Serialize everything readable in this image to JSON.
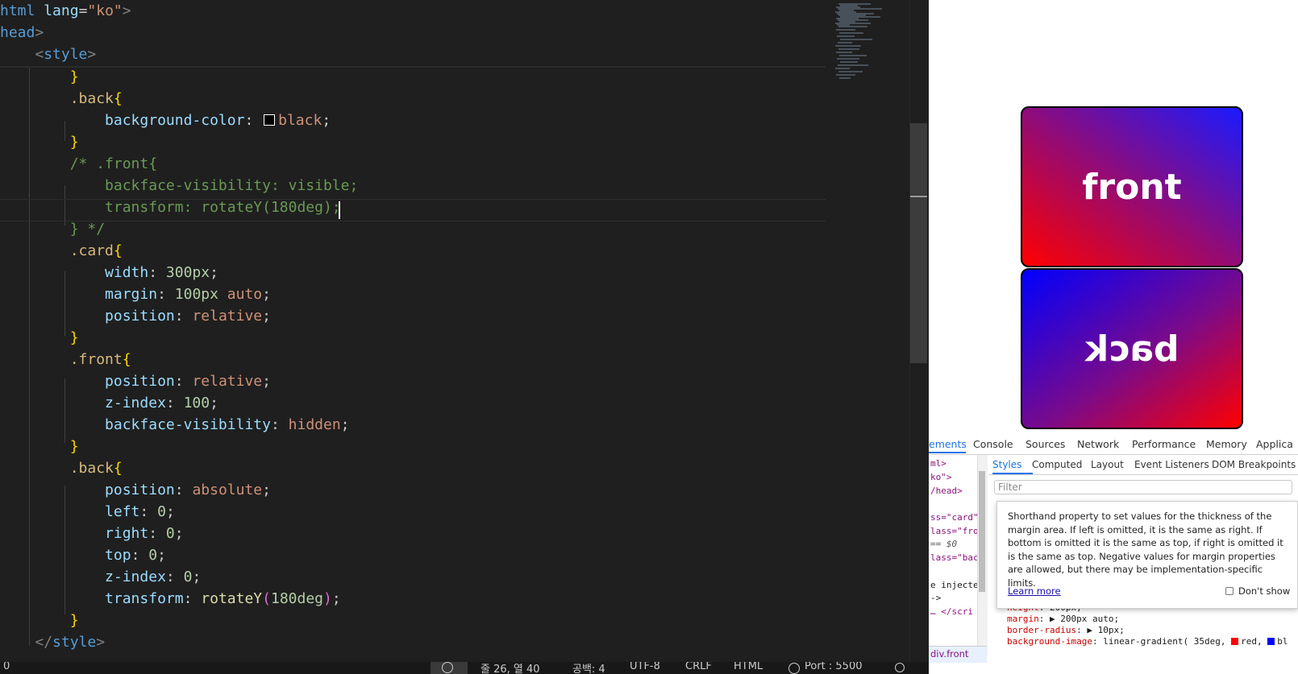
{
  "editor": {
    "lines": [
      {
        "parts": [
          [
            "t-tag",
            "html"
          ],
          [
            "t-plain",
            " "
          ],
          [
            "t-attr",
            "lang"
          ],
          [
            "t-plain",
            "="
          ],
          [
            "t-str",
            "\"ko\""
          ],
          [
            "t-br",
            ">"
          ]
        ]
      },
      {
        "parts": [
          [
            "t-tag",
            "head"
          ],
          [
            "t-br",
            ">"
          ]
        ]
      },
      {
        "parts": [
          [
            "t-plain",
            "    "
          ],
          [
            "t-br",
            "<"
          ],
          [
            "t-tag",
            "style"
          ],
          [
            "t-br",
            ">"
          ]
        ]
      },
      {
        "parts": [
          [
            "t-plain",
            "        "
          ],
          [
            "t-brace",
            "}"
          ]
        ]
      },
      {
        "parts": [
          [
            "t-plain",
            "        "
          ],
          [
            "t-sel",
            ".back"
          ],
          [
            "t-brace",
            "{"
          ]
        ]
      },
      {
        "parts": [
          [
            "t-plain",
            "            "
          ],
          [
            "t-prop",
            "background-color"
          ],
          [
            "t-plain",
            ": "
          ],
          [
            "swatch",
            ""
          ],
          [
            "t-val",
            "black"
          ],
          [
            "t-plain",
            ";"
          ]
        ]
      },
      {
        "parts": [
          [
            "t-plain",
            "        "
          ],
          [
            "t-brace",
            "}"
          ]
        ]
      },
      {
        "parts": [
          [
            "t-plain",
            "        "
          ],
          [
            "t-com",
            "/* .front{"
          ]
        ]
      },
      {
        "parts": [
          [
            "t-plain",
            "            "
          ],
          [
            "t-com",
            "backface-visibility: visible;"
          ]
        ]
      },
      {
        "parts": [
          [
            "t-plain",
            "            "
          ],
          [
            "t-com",
            "transform: rotateY(180deg);"
          ]
        ]
      },
      {
        "parts": [
          [
            "t-plain",
            "        "
          ],
          [
            "t-com",
            "} */"
          ]
        ]
      },
      {
        "parts": [
          [
            "t-plain",
            "        "
          ],
          [
            "t-sel",
            ".card"
          ],
          [
            "t-brace",
            "{"
          ]
        ]
      },
      {
        "parts": [
          [
            "t-plain",
            "            "
          ],
          [
            "t-prop",
            "width"
          ],
          [
            "t-plain",
            ": "
          ],
          [
            "t-num",
            "300px"
          ],
          [
            "t-plain",
            ";"
          ]
        ]
      },
      {
        "parts": [
          [
            "t-plain",
            "            "
          ],
          [
            "t-prop",
            "margin"
          ],
          [
            "t-plain",
            ": "
          ],
          [
            "t-num",
            "100px"
          ],
          [
            "t-plain",
            " "
          ],
          [
            "t-val",
            "auto"
          ],
          [
            "t-plain",
            ";"
          ]
        ]
      },
      {
        "parts": [
          [
            "t-plain",
            "            "
          ],
          [
            "t-prop",
            "position"
          ],
          [
            "t-plain",
            ": "
          ],
          [
            "t-val",
            "relative"
          ],
          [
            "t-plain",
            ";"
          ]
        ]
      },
      {
        "parts": [
          [
            "t-plain",
            "        "
          ],
          [
            "t-brace",
            "}"
          ]
        ]
      },
      {
        "parts": [
          [
            "t-plain",
            "        "
          ],
          [
            "t-sel",
            ".front"
          ],
          [
            "t-brace",
            "{"
          ]
        ]
      },
      {
        "parts": [
          [
            "t-plain",
            "            "
          ],
          [
            "t-prop",
            "position"
          ],
          [
            "t-plain",
            ": "
          ],
          [
            "t-val",
            "relative"
          ],
          [
            "t-plain",
            ";"
          ]
        ]
      },
      {
        "parts": [
          [
            "t-plain",
            "            "
          ],
          [
            "t-prop",
            "z-index"
          ],
          [
            "t-plain",
            ": "
          ],
          [
            "t-num",
            "100"
          ],
          [
            "t-plain",
            ";"
          ]
        ]
      },
      {
        "parts": [
          [
            "t-plain",
            "            "
          ],
          [
            "t-prop",
            "backface-visibility"
          ],
          [
            "t-plain",
            ": "
          ],
          [
            "t-val",
            "hidden"
          ],
          [
            "t-plain",
            ";"
          ]
        ]
      },
      {
        "parts": [
          [
            "t-plain",
            "        "
          ],
          [
            "t-brace",
            "}"
          ]
        ]
      },
      {
        "parts": [
          [
            "t-plain",
            "        "
          ],
          [
            "t-sel",
            ".back"
          ],
          [
            "t-brace",
            "{"
          ]
        ]
      },
      {
        "parts": [
          [
            "t-plain",
            "            "
          ],
          [
            "t-prop",
            "position"
          ],
          [
            "t-plain",
            ": "
          ],
          [
            "t-val",
            "absolute"
          ],
          [
            "t-plain",
            ";"
          ]
        ]
      },
      {
        "parts": [
          [
            "t-plain",
            "            "
          ],
          [
            "t-prop",
            "left"
          ],
          [
            "t-plain",
            ": "
          ],
          [
            "t-num",
            "0"
          ],
          [
            "t-plain",
            ";"
          ]
        ]
      },
      {
        "parts": [
          [
            "t-plain",
            "            "
          ],
          [
            "t-prop",
            "right"
          ],
          [
            "t-plain",
            ": "
          ],
          [
            "t-num",
            "0"
          ],
          [
            "t-plain",
            ";"
          ]
        ]
      },
      {
        "parts": [
          [
            "t-plain",
            "            "
          ],
          [
            "t-prop",
            "top"
          ],
          [
            "t-plain",
            ": "
          ],
          [
            "t-num",
            "0"
          ],
          [
            "t-plain",
            ";"
          ]
        ]
      },
      {
        "parts": [
          [
            "t-plain",
            "            "
          ],
          [
            "t-prop",
            "z-index"
          ],
          [
            "t-plain",
            ": "
          ],
          [
            "t-num",
            "0"
          ],
          [
            "t-plain",
            ";"
          ]
        ]
      },
      {
        "parts": [
          [
            "t-plain",
            "            "
          ],
          [
            "t-prop",
            "transform"
          ],
          [
            "t-plain",
            ": "
          ],
          [
            "t-fn",
            "rotateY"
          ],
          [
            "t-brace2",
            "("
          ],
          [
            "t-num",
            "180deg"
          ],
          [
            "t-brace2",
            ")"
          ],
          [
            "t-plain",
            ";"
          ]
        ]
      },
      {
        "parts": [
          [
            "t-plain",
            "        "
          ],
          [
            "t-brace",
            "}"
          ]
        ]
      },
      {
        "parts": [
          [
            "t-plain",
            "    "
          ],
          [
            "t-br",
            "</"
          ],
          [
            "t-tag",
            "style"
          ],
          [
            "t-br",
            ">"
          ]
        ]
      }
    ],
    "colors": {
      "background": "#1f1f1f",
      "accent": "#569cd6"
    }
  },
  "statusbar": {
    "left": "0",
    "cursor_pos": "줄 26, 열 40",
    "indent": "공백: 4",
    "encoding": "UTF-8",
    "eol": "CRLF",
    "language": "HTML",
    "port": "Port : 5500"
  },
  "preview": {
    "front_label": "front",
    "back_label": "back"
  },
  "devtools": {
    "tabs": [
      "ements",
      "Console",
      "Sources",
      "Network",
      "Performance",
      "Memory",
      "Applica"
    ],
    "subtabs": [
      "Styles",
      "Computed",
      "Layout",
      "Event Listeners",
      "DOM Breakpoints"
    ],
    "filter_placeholder": "Filter",
    "dom_lines": [
      "ml>",
      "ko\">",
      "/head>",
      "ss=\"card\"",
      "lass=\"fro",
      " == $0",
      "lass=\"bac",
      "e injecte",
      "->",
      "… </scri"
    ],
    "dom_selected": "div.front",
    "tooltip": {
      "text": "Shorthand property to set values for the thickness of the margin area. If left is omitted, it is the same as right. If bottom is omitted it is the same as top, if right is omitted it is the same as top. Negative values for margin properties are allowed, but there may be implementation-specific limits.",
      "learn_more": "Learn more",
      "dont_show": "Don't show"
    },
    "css_rules": [
      {
        "prop": "height",
        "val": " 200px;"
      },
      {
        "prop": "margin",
        "val": " ▶ 200px auto;"
      },
      {
        "prop": "border-radius",
        "val": " ▶ 10px;"
      },
      {
        "prop": "background-image",
        "val": " linear-gradient(  35deg, ",
        "extra": [
          "red, ",
          "bl"
        ]
      }
    ]
  }
}
